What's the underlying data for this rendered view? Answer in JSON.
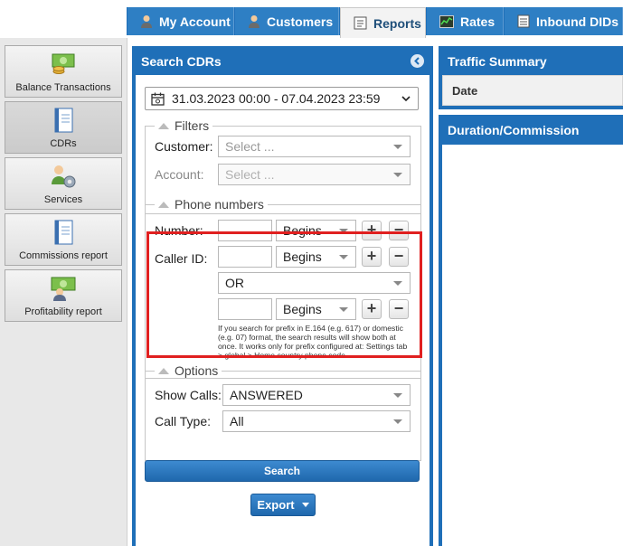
{
  "tabs": [
    {
      "label": "My Account",
      "icon": "user-icon"
    },
    {
      "label": "Customers",
      "icon": "users-icon"
    },
    {
      "label": "Reports",
      "icon": "report-icon",
      "active": true
    },
    {
      "label": "Rates",
      "icon": "chart-icon"
    },
    {
      "label": "Inbound DIDs",
      "icon": "list-icon"
    }
  ],
  "sidebar": {
    "items": [
      {
        "label": "Balance Transactions",
        "icon": "money-icon"
      },
      {
        "label": "CDRs",
        "icon": "notebook-icon",
        "active": true
      },
      {
        "label": "Services",
        "icon": "services-icon"
      },
      {
        "label": "Commissions report",
        "icon": "notebook-icon"
      },
      {
        "label": "Profitability report",
        "icon": "profit-icon"
      }
    ]
  },
  "search": {
    "title": "Search CDRs",
    "date_range": "31.03.2023 00:00 - 07.04.2023 23:59",
    "filters": {
      "legend": "Filters",
      "customer_label": "Customer:",
      "customer_placeholder": "Select ...",
      "account_label": "Account:",
      "account_placeholder": "Select ..."
    },
    "phone": {
      "legend": "Phone numbers",
      "number_label": "Number:",
      "number_match": "Begins",
      "caller_label": "Caller ID:",
      "caller_match_1": "Begins",
      "operator": "OR",
      "caller_match_2": "Begins",
      "plus": "+",
      "minus": "−",
      "note": "If you search for prefix in E.164 (e.g. 617) or domestic (e.g. 07) format, the search results will show both at once. It works only for prefix configured at: Settings tab > global > Home country phone code"
    },
    "options": {
      "legend": "Options",
      "show_calls_label": "Show Calls:",
      "show_calls_value": "ANSWERED",
      "call_type_label": "Call Type:",
      "call_type_value": "All"
    },
    "search_button": "Search",
    "export_button": "Export"
  },
  "traffic": {
    "title": "Traffic Summary",
    "column": "Date"
  },
  "duration": {
    "title": "Duration/Commission"
  },
  "colors": {
    "accent": "#1f6fb8",
    "highlight": "#e02020"
  }
}
